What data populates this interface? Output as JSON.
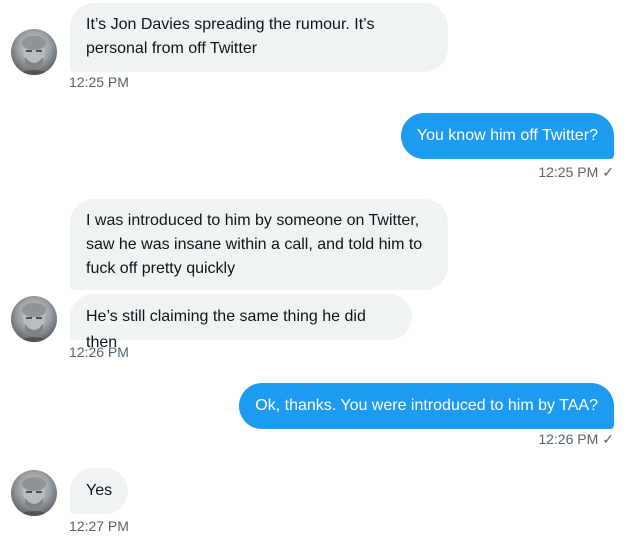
{
  "conversation": {
    "messages": [
      {
        "side": "in",
        "text": "It’s Jon Davies spreading the rumour. It’s personal from off Twitter"
      },
      {
        "side": "out",
        "text": "You know him off Twitter?"
      },
      {
        "side": "in",
        "text": "I was introduced to him by someone on Twitter, saw he was insane within a call, and told him to fuck off pretty quickly"
      },
      {
        "side": "in",
        "text": "He’s still claiming the same thing he did then"
      },
      {
        "side": "out",
        "text": "Ok, thanks. You were introduced to him by TAA?"
      },
      {
        "side": "in",
        "text": "Yes"
      }
    ],
    "timestamps": {
      "t1": "12:25 PM",
      "t2": "12:25 PM",
      "t3": "12:26 PM",
      "t4": "12:26 PM",
      "t5": "12:27 PM"
    },
    "read_mark": "✓"
  },
  "colors": {
    "incoming_bubble": "#eff3f4",
    "outgoing_bubble": "#1d9bf0",
    "timestamp": "#536471"
  },
  "icons": [
    "avatar",
    "checkmark-icon"
  ]
}
